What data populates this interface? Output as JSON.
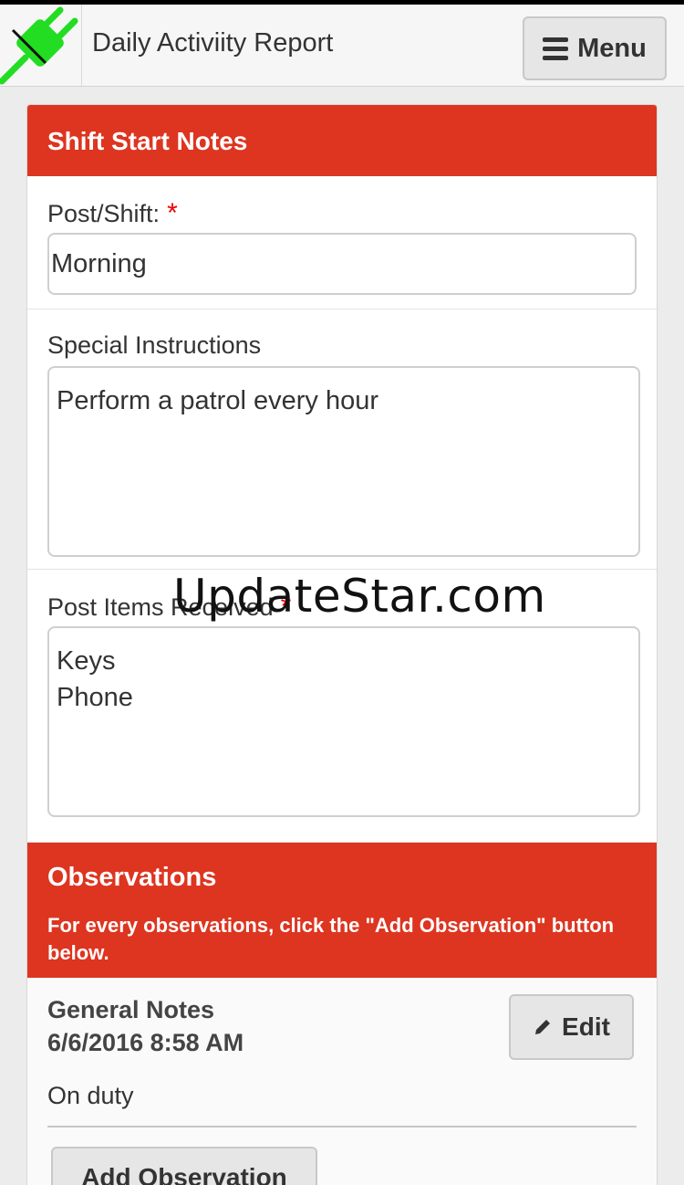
{
  "app": {
    "title": "Daily Activiity Report",
    "menu_label": "Menu",
    "logo_icon": "green-plug-icon",
    "logo_color": "#22dd22"
  },
  "shift_start": {
    "header": "Shift Start Notes",
    "post_shift": {
      "label": "Post/Shift:",
      "required": "*",
      "value": "Morning"
    },
    "special_instructions": {
      "label": "Special Instructions",
      "value": "Perform a patrol every hour"
    },
    "post_items": {
      "label": "Post Items Received",
      "required": "*",
      "value": "Keys\nPhone"
    }
  },
  "observations": {
    "header": "Observations",
    "subtext": "For every observations, click the \"Add Observation\" button below.",
    "items": [
      {
        "title": "General Notes",
        "datetime": "6/6/2016 8:58 AM",
        "note": "On duty",
        "edit_label": "Edit"
      }
    ],
    "add_label": "Add Observation"
  },
  "watermark": "UpdateStar.com",
  "colors": {
    "accent_red": "#dd3520",
    "required_red": "#ee0000"
  }
}
